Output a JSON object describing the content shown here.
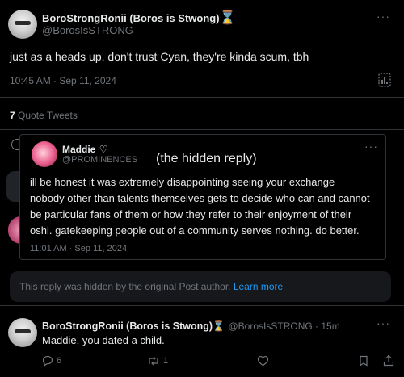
{
  "main_post": {
    "display_name": "BoroStrongRonii (Boros is Stwong)",
    "hourglass": "⌛",
    "handle": "@BorosIsSTRONG",
    "text": "just as a heads up, don't trust Cyan, they're kinda scum, tbh",
    "timestamp": "10:45 AM · Sep 11, 2024",
    "more": "···"
  },
  "quote_tweets": {
    "count": "7",
    "label": "Quote Tweets"
  },
  "hidden_reply": {
    "display_name": "Maddie",
    "heart": "♡",
    "handle": "@PROMINENCES",
    "annotation": "(the hidden reply)",
    "text_lines": [
      "ill be honest it was extremely disappointing seeing your exchange",
      "nobody other than talents themselves gets to decide who can and cannot",
      "be particular fans of them or how they refer to their enjoyment of their",
      "oshi. gatekeeping people out of a community serves nothing. do better."
    ],
    "timestamp": "11:01 AM · Sep 11, 2024",
    "more": "···"
  },
  "hidden_banner": {
    "text": "This reply was hidden by the original Post author.",
    "link": "Learn more"
  },
  "reply": {
    "display_name": "BoroStrongRonii (Boros is Stwong)",
    "hourglass": "⌛",
    "handle_time": "@BorosIsSTRONG · 15m",
    "text": "Maddie, you dated a child.",
    "more": "···",
    "reply_count": "6",
    "retweet_count": "1"
  },
  "icons": {
    "reply": "comment-icon",
    "retweet": "retweet-icon",
    "like": "heart-icon",
    "bookmark": "bookmark-icon",
    "share": "share-icon",
    "analytics": "analytics-icon"
  },
  "colors": {
    "background": "#000000",
    "text": "#e7e9ea",
    "muted": "#71767b",
    "link": "#1d9bf0",
    "banner": "#16181c"
  }
}
